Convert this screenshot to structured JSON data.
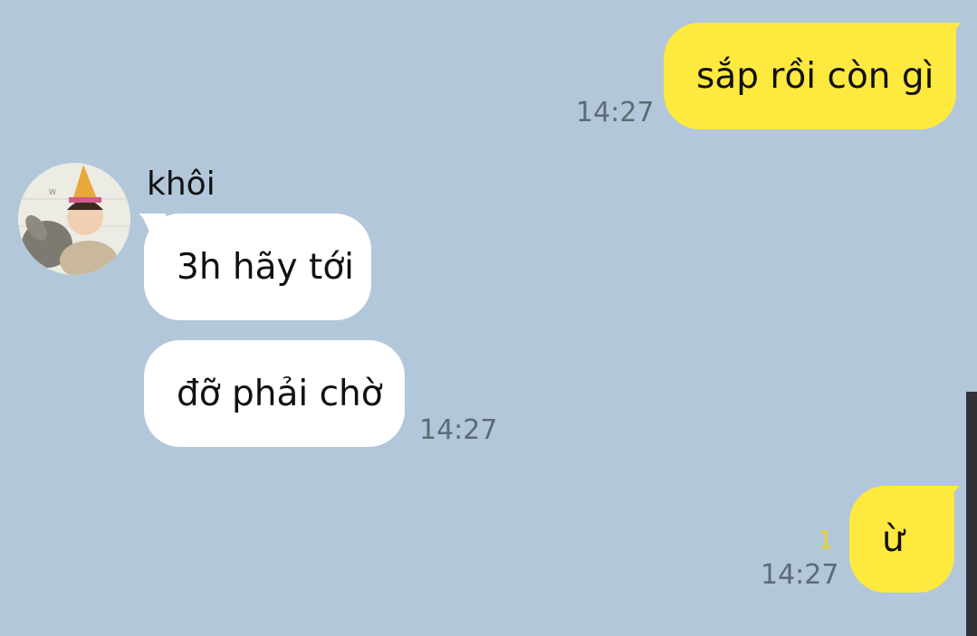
{
  "chat": {
    "messages": [
      {
        "sender": "me",
        "text": "sắp rồi còn gì",
        "time": "14:27"
      },
      {
        "sender": "other",
        "name": "khôi",
        "text": "3h hãy tới"
      },
      {
        "sender": "other",
        "text": "đỡ phải chờ",
        "time": "14:27"
      },
      {
        "sender": "me",
        "text": "ừ",
        "time": "14:27",
        "unread": "1"
      }
    ]
  },
  "colors": {
    "background": "#b2c7da",
    "my_bubble": "#fee93f",
    "other_bubble": "#ffffff",
    "time_text": "#5f6b75",
    "unread_count": "#ead236"
  },
  "icons": {
    "avatar": "contact-avatar-photo"
  }
}
